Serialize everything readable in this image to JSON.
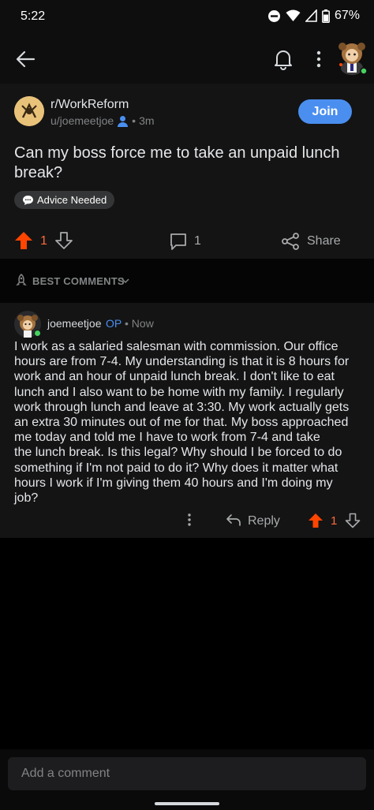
{
  "status_bar": {
    "time": "5:22",
    "battery": "67%"
  },
  "subreddit": {
    "name": "r/WorkReform",
    "author": "u/joemeetjoe",
    "age": "3m",
    "join_label": "Join"
  },
  "post": {
    "title": "Can my boss force me to take an unpaid lunch break?",
    "flair": "Advice Needed",
    "votes": "1",
    "comments": "1",
    "share_label": "Share"
  },
  "sort": {
    "label": "BEST COMMENTS"
  },
  "comment": {
    "author": "joemeetjoe",
    "op_label": "OP",
    "time": "Now",
    "body_lines": [
      "I work as a salaried salesman with commission. Our office",
      "hours are from 7-4. My understanding is that it is 8 hours for",
      "work and an hour of unpaid lunch break. I don't like to eat",
      "lunch and I also want to be home with my family. I regularly",
      "work through lunch and leave at 3:30. My work actually gets",
      "an extra 30 minutes out of me for that. My boss approached",
      "me today and told me I have to work from 7-4 and take",
      "the lunch break. Is this legal? Why should I be forced to do",
      "something if I'm not paid to do it? Why does it matter what",
      "hours I work if I'm giving them 40 hours and I'm doing my",
      "job?"
    ],
    "reply_label": "Reply",
    "votes": "1"
  },
  "comment_input": {
    "placeholder": "Add a comment"
  },
  "colors": {
    "upvote": "#ff4500",
    "join": "#4a8ff0",
    "op": "#4a8ff0",
    "online": "#46d160"
  }
}
